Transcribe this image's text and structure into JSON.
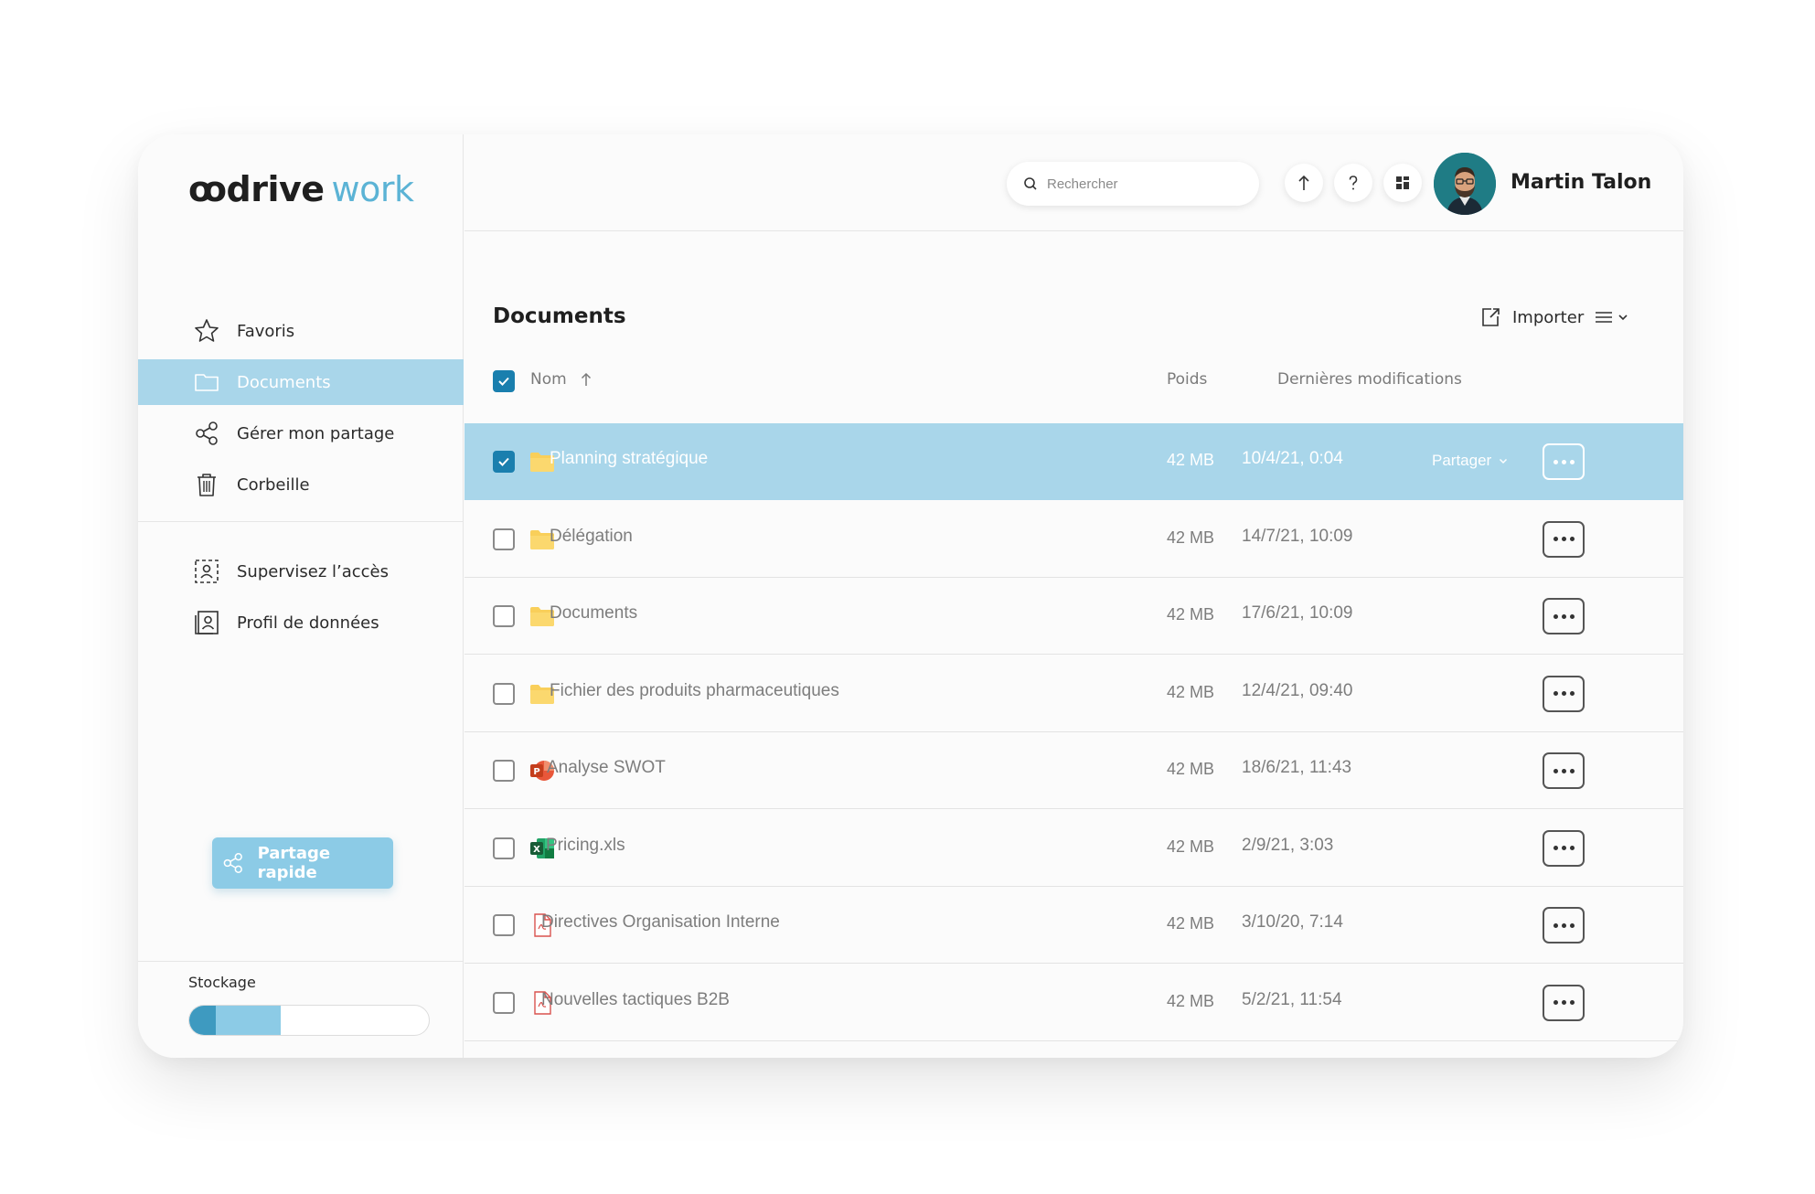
{
  "app": {
    "brand": "ꝏdrive",
    "brand_suffix": "work"
  },
  "sidebar": {
    "items": [
      {
        "label": "Favoris",
        "icon": "star-icon",
        "active": false
      },
      {
        "label": "Documents",
        "icon": "folder-icon",
        "active": true
      },
      {
        "label": "Gérer mon partage",
        "icon": "share-icon",
        "active": false
      },
      {
        "label": "Corbeille",
        "icon": "trash-icon",
        "active": false
      }
    ],
    "admin_items": [
      {
        "label": "Supervisez l’accès",
        "icon": "access-icon"
      },
      {
        "label": "Profil de données",
        "icon": "profile-icon"
      }
    ],
    "quick_share_label": "Partage rapide",
    "storage_label": "Stockage",
    "storage_used_fraction": 0.38,
    "storage_used_dark_fraction": 0.11
  },
  "header": {
    "search_placeholder": "Rechercher",
    "user_name": "Martin Talon"
  },
  "main": {
    "title": "Documents",
    "import_label": "Importer",
    "columns": {
      "name": "Nom",
      "size": "Poids",
      "modified": "Dernières modifications"
    },
    "share_label": "Partager",
    "files": [
      {
        "name": "Planning stratégique",
        "type": "folder",
        "size": "42 MB",
        "modified": "10/4/21, 0:04",
        "selected": true
      },
      {
        "name": "Délégation",
        "type": "folder",
        "size": "42 MB",
        "modified": "14/7/21, 10:09",
        "selected": false
      },
      {
        "name": "Documents",
        "type": "folder",
        "size": "42 MB",
        "modified": "17/6/21, 10:09",
        "selected": false
      },
      {
        "name": "Fichier des produits pharmaceutiques",
        "type": "folder",
        "size": "42 MB",
        "modified": "12/4/21, 09:40",
        "selected": false
      },
      {
        "name": "Analyse SWOT",
        "type": "powerpoint",
        "size": "42 MB",
        "modified": "18/6/21, 11:43",
        "selected": false
      },
      {
        "name": "Pricing.xls",
        "type": "excel",
        "size": "42 MB",
        "modified": "2/9/21, 3:03",
        "selected": false
      },
      {
        "name": "Directives Organisation Interne",
        "type": "pdf",
        "size": "42 MB",
        "modified": "3/10/20, 7:14",
        "selected": false
      },
      {
        "name": "Nouvelles tactiques B2B",
        "type": "pdf",
        "size": "42 MB",
        "modified": "5/2/21, 11:54",
        "selected": false
      }
    ]
  },
  "colors": {
    "accent": "#a9d6ea",
    "accent_strong": "#1a7fae",
    "brand_work": "#5bb3d5",
    "folder": "#f9cf5a"
  }
}
